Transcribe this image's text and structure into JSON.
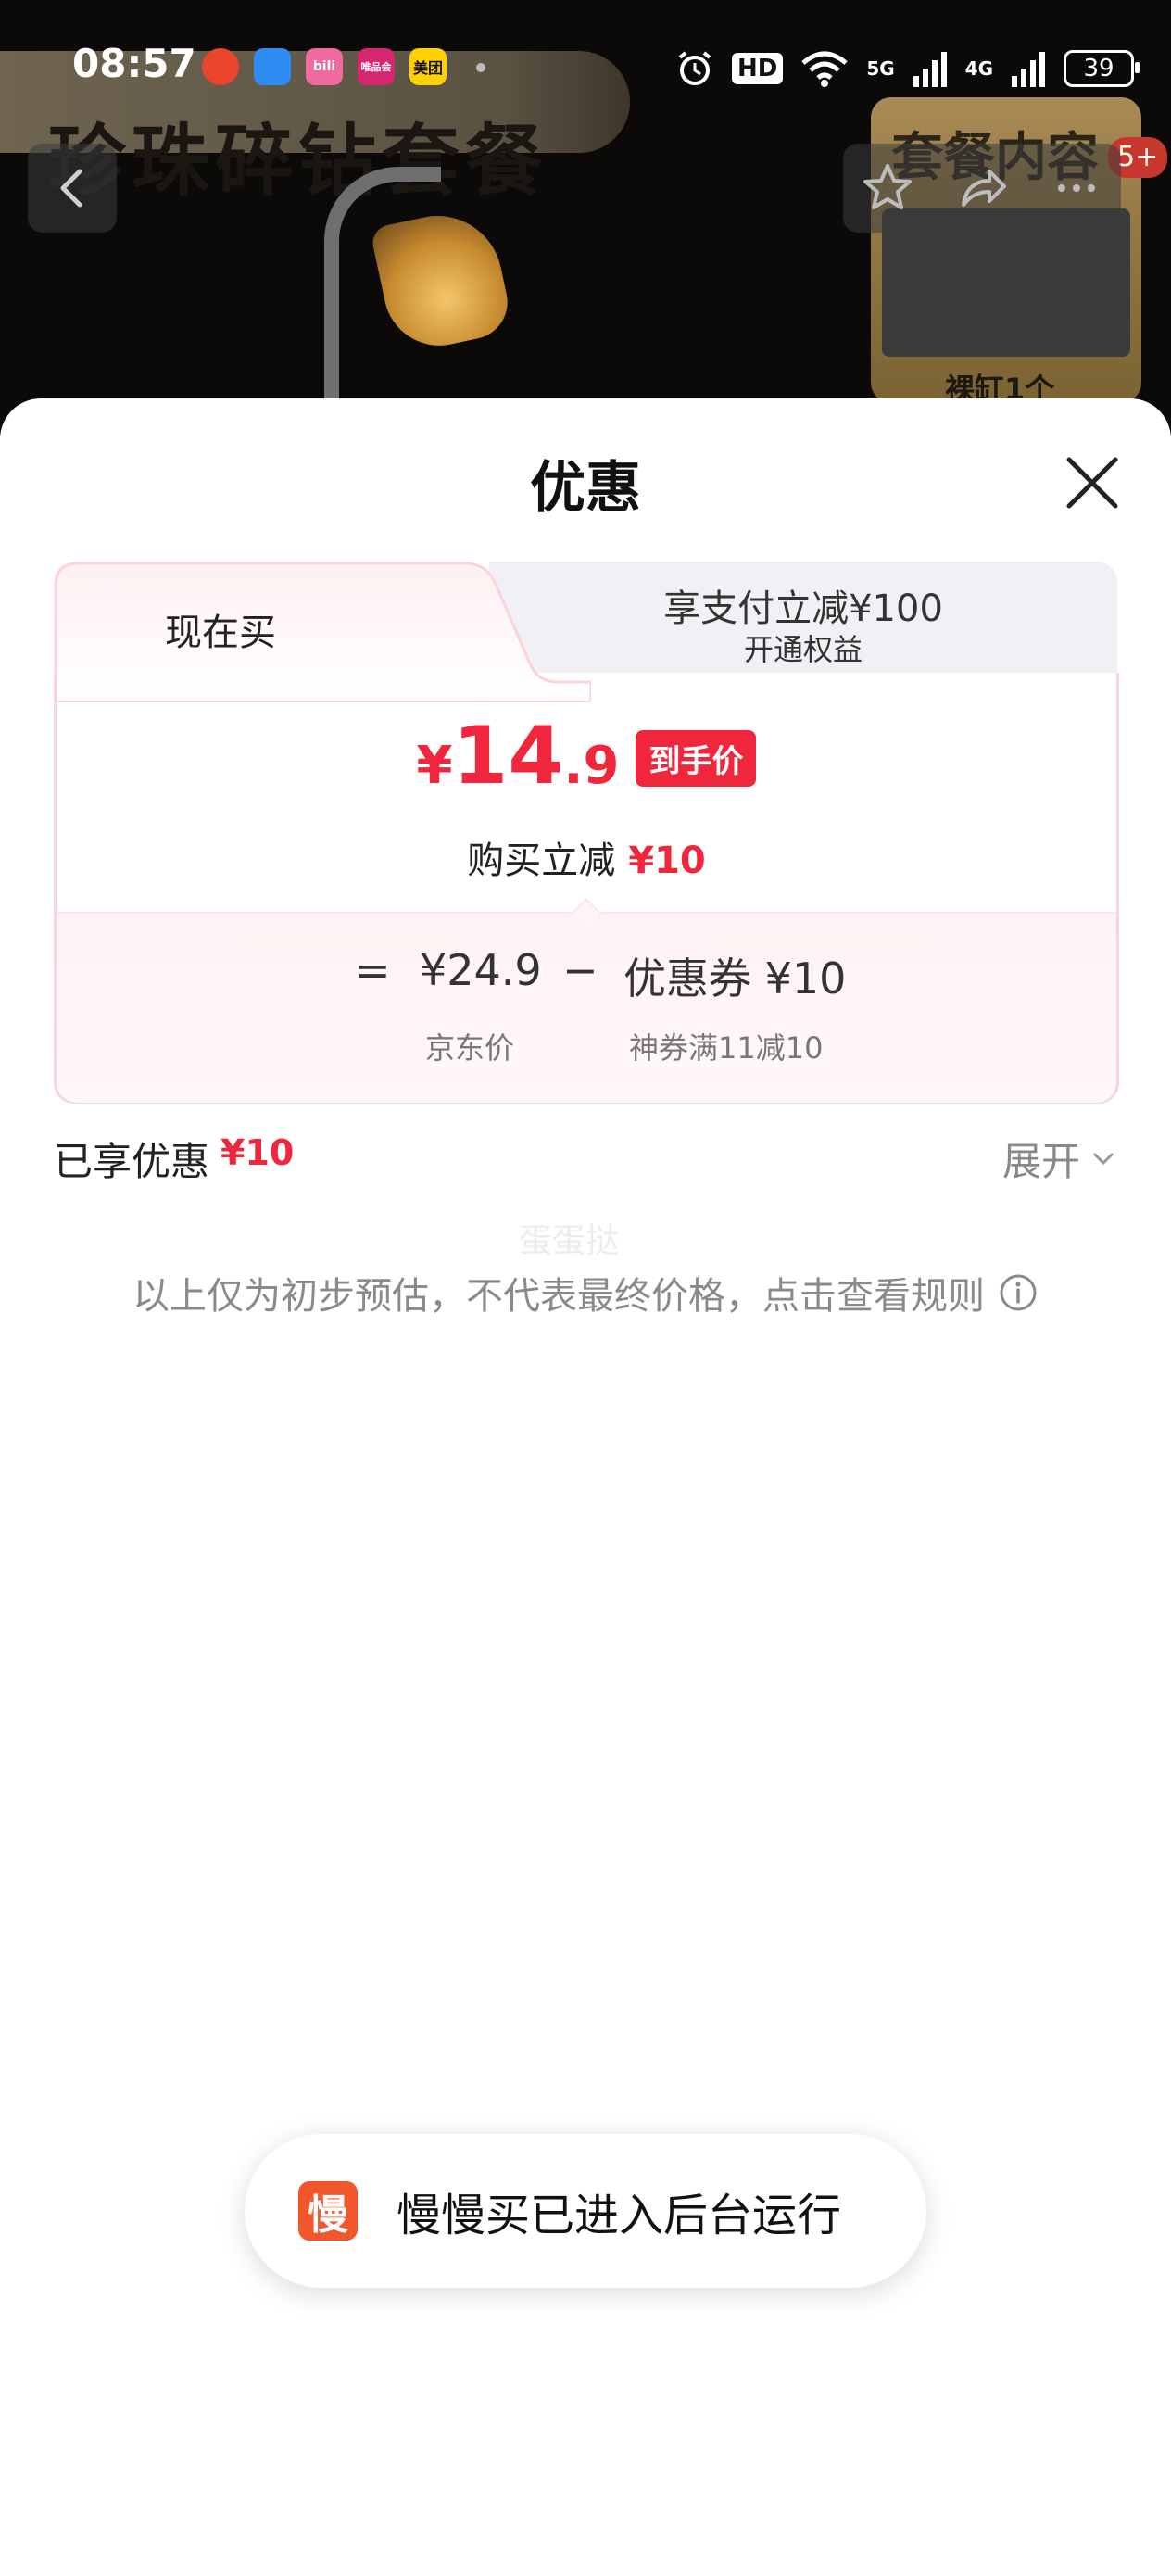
{
  "status_bar": {
    "time": "08:57",
    "apps": [
      "",
      "",
      "bili",
      "唯品会",
      "美团"
    ],
    "hd": "HD",
    "network1": "5G",
    "network2": "4G",
    "battery": "39"
  },
  "background": {
    "banner_title": "珍珠碎钻套餐",
    "thumb_title": "套餐内容",
    "thumb_caption": "裸缸1个",
    "badge": "5+"
  },
  "sheet": {
    "title": "优惠",
    "tabs": {
      "active_label": "现在买",
      "inactive_title": "享支付立减¥100",
      "inactive_sub": "开通权益"
    },
    "price": {
      "currency": "¥",
      "integer": "14",
      "decimal": ".9",
      "badge": "到手价"
    },
    "reduce": {
      "label": "购买立减",
      "amount": "¥10"
    },
    "breakdown": {
      "eq": "=",
      "base_price": "¥24.9",
      "minus": "−",
      "coupon": "优惠券 ¥10",
      "base_caption": "京东价",
      "coupon_caption": "神券满11减10"
    },
    "discount": {
      "label": "已享优惠",
      "amount": "¥10",
      "expand": "展开"
    },
    "watermark": "蛋蛋挞",
    "disclaimer": "以上仅为初步预估，不代表最终价格，点击查看规则"
  },
  "toast": {
    "icon": "慢",
    "text": "慢慢买已进入后台运行"
  },
  "colors": {
    "accent": "#f0263d",
    "toast_icon": "#f2572c"
  }
}
